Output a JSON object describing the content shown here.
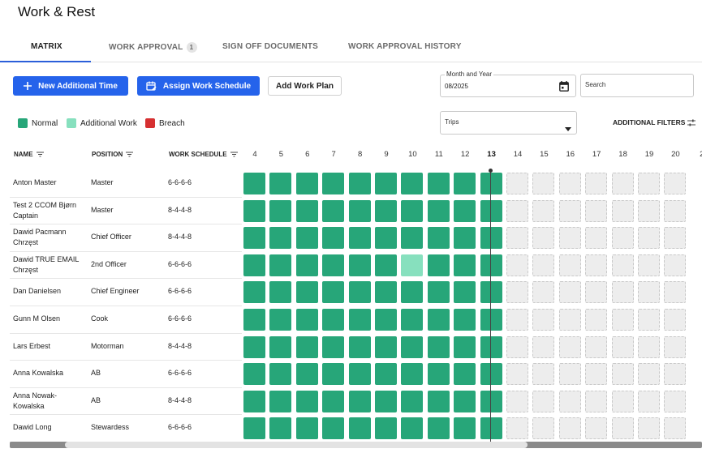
{
  "page": {
    "title": "Work & Rest"
  },
  "tabs": [
    {
      "label": "MATRIX",
      "active": true
    },
    {
      "label": "WORK APPROVAL",
      "badge": "1"
    },
    {
      "label": "SIGN OFF DOCUMENTS"
    },
    {
      "label": "WORK APPROVAL HISTORY"
    }
  ],
  "toolbar": {
    "new_time_label": "New Additional Time",
    "assign_label": "Assign Work Schedule",
    "add_plan_label": "Add Work Plan"
  },
  "month_field": {
    "label": "Month and Year",
    "value": "08/2025"
  },
  "search_field": {
    "placeholder": "Search"
  },
  "trips_field": {
    "placeholder": "Trips"
  },
  "additional_filters_label": "ADDITIONAL FILTERS",
  "legend": [
    {
      "label": "Normal",
      "color": "#27a679"
    },
    {
      "label": "Additional Work",
      "color": "#87e0be"
    },
    {
      "label": "Breach",
      "color": "#d63031"
    }
  ],
  "columns": {
    "name": "NAME",
    "position": "POSITION",
    "schedule": "WORK SCHEDULE"
  },
  "days": [
    "4",
    "5",
    "6",
    "7",
    "8",
    "9",
    "10",
    "11",
    "12",
    "13",
    "14",
    "15",
    "16",
    "17",
    "18",
    "19",
    "20",
    "2"
  ],
  "today_day": "13",
  "crew": [
    {
      "name": "Anton Master",
      "position": "Master",
      "schedule": "6-6-6-6"
    },
    {
      "name": "Test 2 CCOM Bjørn Captain",
      "position": "Master",
      "schedule": "8-4-4-8"
    },
    {
      "name": "Dawid Pacmann Chrzęst",
      "position": "Chief Officer",
      "schedule": "8-4-4-8"
    },
    {
      "name": "Dawid TRUE EMAIL Chrzęst",
      "position": "2nd Officer",
      "schedule": "6-6-6-6"
    },
    {
      "name": "Dan Danielsen",
      "position": "Chief Engineer",
      "schedule": "6-6-6-6"
    },
    {
      "name": "Gunn M Olsen",
      "position": "Cook",
      "schedule": "6-6-6-6"
    },
    {
      "name": "Lars Erbest",
      "position": "Motorman",
      "schedule": "8-4-4-8"
    },
    {
      "name": "Anna Kowalska",
      "position": "AB",
      "schedule": "6-6-6-6"
    },
    {
      "name": "Anna Nowak-Kowalska",
      "position": "AB",
      "schedule": "8-4-4-8"
    },
    {
      "name": "Dawid Long",
      "position": "Stewardess",
      "schedule": "6-6-6-6"
    }
  ],
  "matrix": [
    [
      "N",
      "N",
      "N",
      "N",
      "N",
      "N",
      "N",
      "N",
      "N",
      "N",
      "F",
      "F",
      "F",
      "F",
      "F",
      "F",
      "F",
      "F"
    ],
    [
      "N",
      "N",
      "N",
      "N",
      "N",
      "N",
      "N",
      "N",
      "N",
      "N",
      "F",
      "F",
      "F",
      "F",
      "F",
      "F",
      "F",
      "F"
    ],
    [
      "N",
      "N",
      "N",
      "N",
      "N",
      "N",
      "N",
      "N",
      "N",
      "N",
      "F",
      "F",
      "F",
      "F",
      "F",
      "F",
      "F",
      "F"
    ],
    [
      "N",
      "N",
      "N",
      "N",
      "N",
      "N",
      "A",
      "N",
      "N",
      "N",
      "F",
      "F",
      "F",
      "F",
      "F",
      "F",
      "F",
      "F"
    ],
    [
      "N",
      "N",
      "N",
      "N",
      "N",
      "N",
      "N",
      "N",
      "N",
      "N",
      "F",
      "F",
      "F",
      "F",
      "F",
      "F",
      "F",
      "F"
    ],
    [
      "N",
      "N",
      "N",
      "N",
      "N",
      "N",
      "N",
      "N",
      "N",
      "N",
      "F",
      "F",
      "F",
      "F",
      "F",
      "F",
      "F",
      "F"
    ],
    [
      "N",
      "N",
      "N",
      "N",
      "N",
      "N",
      "N",
      "N",
      "N",
      "N",
      "F",
      "F",
      "F",
      "F",
      "F",
      "F",
      "F",
      "F"
    ],
    [
      "N",
      "N",
      "N",
      "N",
      "N",
      "N",
      "N",
      "N",
      "N",
      "N",
      "F",
      "F",
      "F",
      "F",
      "F",
      "F",
      "F",
      "F"
    ],
    [
      "N",
      "N",
      "N",
      "N",
      "N",
      "N",
      "N",
      "N",
      "N",
      "N",
      "F",
      "F",
      "F",
      "F",
      "F",
      "F",
      "F",
      "F"
    ],
    [
      "N",
      "N",
      "N",
      "N",
      "N",
      "N",
      "N",
      "N",
      "N",
      "N",
      "F",
      "F",
      "F",
      "F",
      "F",
      "F",
      "F",
      "F"
    ]
  ]
}
